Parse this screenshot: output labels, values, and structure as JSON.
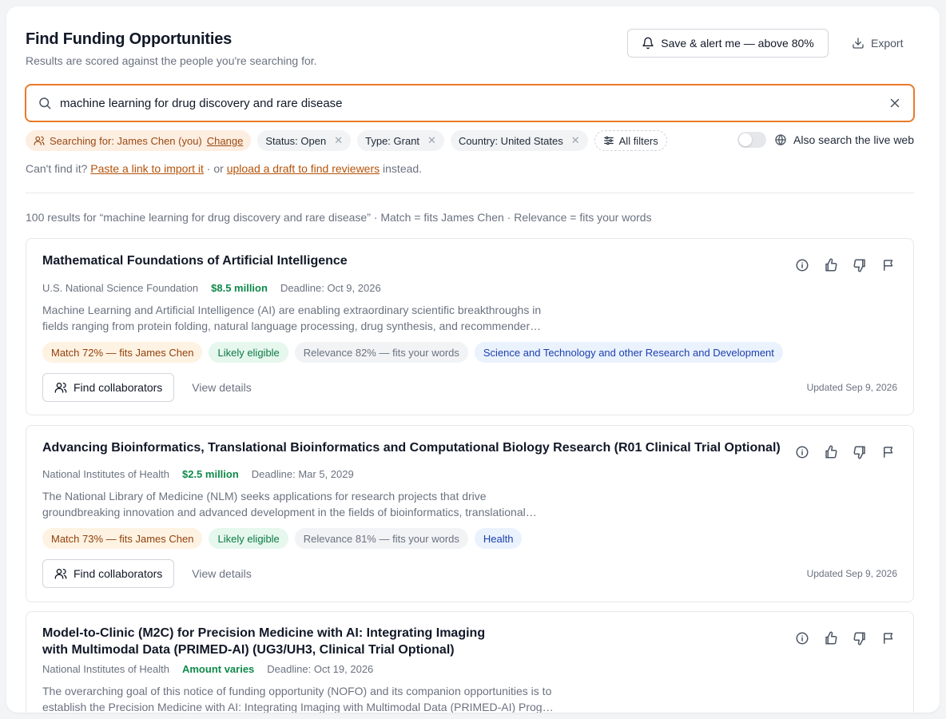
{
  "header": {
    "title": "Find Funding Opportunities",
    "subtitle": "Results are scored against the people you're searching for.",
    "alert_label": "Save & alert me — above 80%",
    "export_label": "Export"
  },
  "search": {
    "value": "machine learning for drug discovery and rare disease"
  },
  "chips": {
    "person_label": "Searching for: James Chen (you)",
    "person_change": "Change",
    "status": "Status: Open",
    "type": "Type: Grant",
    "country": "Country: United States",
    "all_filters": "All filters",
    "live_web_label": "Also search the live web",
    "live_web_on": false
  },
  "import": {
    "prefix": "Can't find it?",
    "link1": "Paste a link to import it",
    "middle": "· or",
    "link2": "upload a draft to find reviewers",
    "suffix": "instead."
  },
  "results_summary": "100 results for “machine learning for drug discovery and rare disease” · Match = fits James Chen · Relevance = fits your words",
  "cards": [
    {
      "title_lines": [
        "Mathematical Foundations of Artificial Intelligence"
      ],
      "agency": "U.S. National Science Foundation",
      "amount": "$8.5 million",
      "deadline": "Deadline: Oct 9, 2026",
      "desc_lines": [
        "Machine Learning and Artificial Intelligence (AI) are enabling extraordinary scientific breakthroughs in",
        "fields ranging from protein folding, natural language processing, drug synthesis, and recommender…"
      ],
      "match": "Match 72% — fits James Chen",
      "eligibility": "Likely eligible",
      "relevance": "Relevance 82% — fits your words",
      "category": "Science and Technology and other Research and Development",
      "collab_label": "Find collaborators",
      "details_label": "View details",
      "updated": "Updated Sep 9, 2026"
    },
    {
      "title_lines": [
        "Advancing Bioinformatics, Translational Bioinformatics and Computational Biology Research (R01 Clinical Trial Optional)"
      ],
      "agency": "National Institutes of Health",
      "amount": "$2.5 million",
      "deadline": "Deadline: Mar 5, 2029",
      "desc_lines": [
        "The National Library of Medicine (NLM) seeks applications for research projects that drive",
        "groundbreaking innovation and advanced development in the fields of bioinformatics, translational…"
      ],
      "match": "Match 73% — fits James Chen",
      "eligibility": "Likely eligible",
      "relevance": "Relevance 81% — fits your words",
      "category": "Health",
      "collab_label": "Find collaborators",
      "details_label": "View details",
      "updated": "Updated Sep 9, 2026"
    },
    {
      "title_lines": [
        "Model-to-Clinic (M2C) for Precision Medicine with AI: Integrating Imaging",
        "with Multimodal Data (PRIMED-AI) (UG3/UH3, Clinical Trial Optional)"
      ],
      "agency": "National Institutes of Health",
      "amount": "Amount varies",
      "deadline": "Deadline: Oct 19, 2026",
      "desc_lines": [
        "The overarching goal of this notice of funding opportunity (NOFO) and its companion opportunities is to",
        "establish the Precision Medicine with AI: Integrating Imaging with Multimodal Data (PRIMED-AI) Progra…"
      ]
    }
  ]
}
